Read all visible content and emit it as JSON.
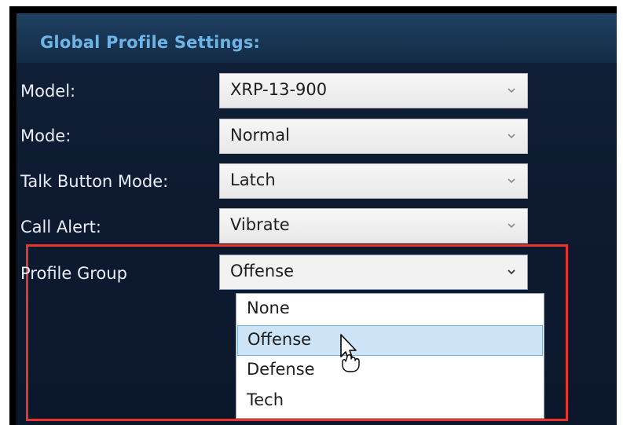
{
  "panel": {
    "title": "Global Profile Settings:"
  },
  "fields": [
    {
      "label": "Model:",
      "value": "XRP-13-900"
    },
    {
      "label": "Mode:",
      "value": "Normal"
    },
    {
      "label": "Talk Button Mode:",
      "value": "Latch"
    },
    {
      "label": "Call Alert:",
      "value": "Vibrate"
    },
    {
      "label": "Profile Group",
      "value": "Offense"
    }
  ],
  "profile_group_options": [
    "None",
    "Offense",
    "Defense",
    "Tech"
  ],
  "hovered_option": "Offense",
  "colors": {
    "panel_bg": "#0d1a30",
    "header_text": "#6fb4e6",
    "highlight_border": "#e8352b",
    "selected_option_bg": "#cce4f6"
  },
  "icons": {
    "dropdown_arrow": "chevron-down-icon",
    "pointer": "mouse-pointer-icon"
  }
}
